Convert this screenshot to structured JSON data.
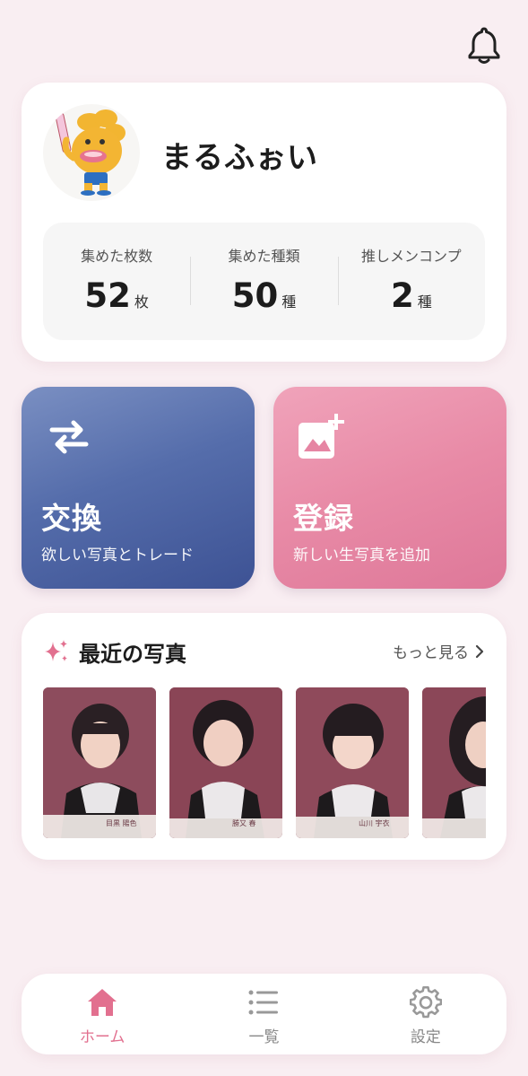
{
  "header": {
    "icon": "bell-icon"
  },
  "profile": {
    "name": "まるふぉい",
    "avatar": "mascot-avatar",
    "stats": [
      {
        "label": "集めた枚数",
        "value": "52",
        "unit": "枚"
      },
      {
        "label": "集めた種類",
        "value": "50",
        "unit": "種"
      },
      {
        "label": "推しメンコンプ",
        "value": "2",
        "unit": "種"
      }
    ]
  },
  "actions": {
    "trade": {
      "title": "交換",
      "subtitle": "欲しい写真とトレード",
      "icon": "swap-arrows-icon",
      "color": "#4e65a6"
    },
    "register": {
      "title": "登録",
      "subtitle": "新しい生写真を追加",
      "icon": "add-photo-icon",
      "color": "#e685a3"
    }
  },
  "recent": {
    "title": "最近の写真",
    "more_label": "もっと見る",
    "icon": "sparkle-icon",
    "photos": [
      {
        "name_tag": "目黒 陽色"
      },
      {
        "name_tag": "勝又 春"
      },
      {
        "name_tag": "山川 宇衣"
      },
      {
        "name_tag": ""
      }
    ]
  },
  "tabbar": {
    "items": [
      {
        "label": "ホーム",
        "icon": "home-icon",
        "active": true
      },
      {
        "label": "一覧",
        "icon": "list-icon",
        "active": false
      },
      {
        "label": "設定",
        "icon": "gear-icon",
        "active": false
      }
    ]
  },
  "colors": {
    "background": "#f9eef2",
    "accent": "#e2708f",
    "trade": "#4e65a6",
    "register": "#e685a3"
  }
}
